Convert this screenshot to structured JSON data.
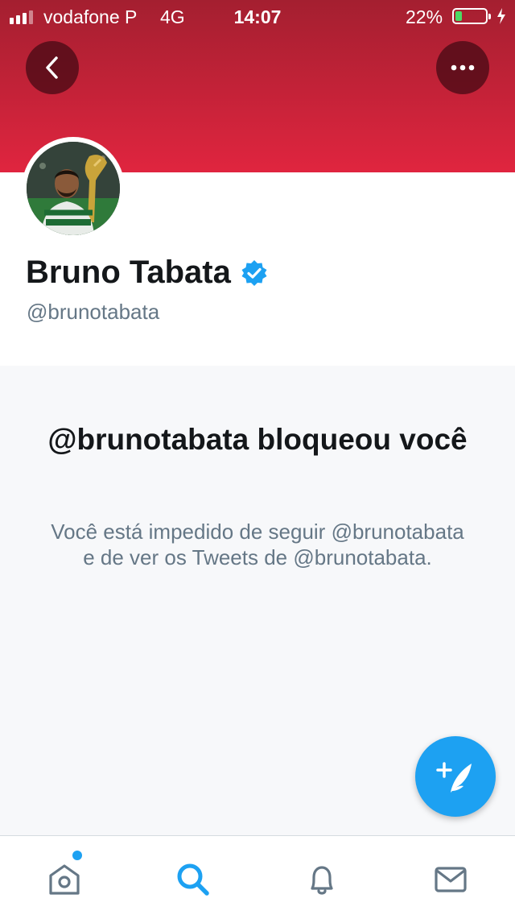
{
  "status_bar": {
    "carrier": "vodafone P",
    "network": "4G",
    "time": "14:07",
    "battery_percent": "22%",
    "battery_level": 0.22
  },
  "header": {
    "back_icon": "chevron-left-icon",
    "more_icon": "more-horizontal-icon",
    "banner_color": "#e0253f"
  },
  "profile": {
    "name": "Bruno Tabata",
    "handle": "@brunotabata",
    "verified": true,
    "verified_icon": "verified-badge-icon"
  },
  "blocked": {
    "title": "@brunotabata bloqueou você",
    "message": "Você está impedido de seguir @brunotabata e de ver os Tweets de @brunotabata."
  },
  "compose": {
    "icon": "compose-tweet-icon",
    "color": "#1da1f2"
  },
  "tab_bar": {
    "items": [
      {
        "icon": "home-icon",
        "has_notification_dot": true
      },
      {
        "icon": "search-icon",
        "active": true
      },
      {
        "icon": "bell-icon"
      },
      {
        "icon": "mail-icon"
      }
    ]
  }
}
